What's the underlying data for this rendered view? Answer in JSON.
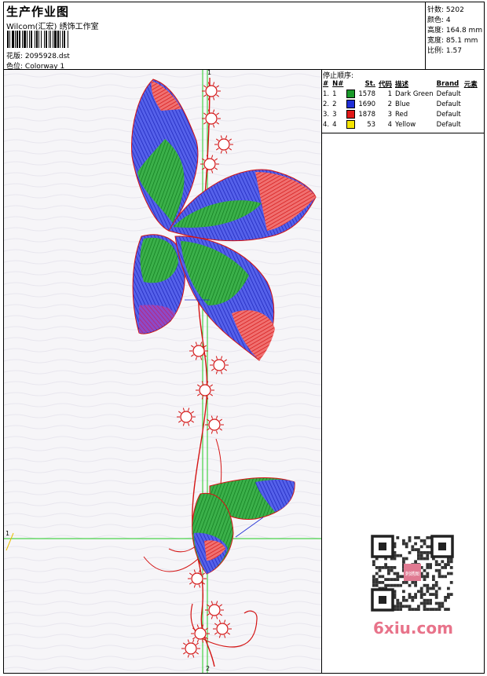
{
  "header": {
    "title": "生产作业图",
    "company": "Wilcom(汇宏) 绣饰工作室",
    "file_label": "花版:",
    "file_value": "2095928.dst",
    "colorway_label": "色位:",
    "colorway_value": "Colorway 1"
  },
  "stats": {
    "stitches_label": "针数:",
    "stitches_value": "5202",
    "colors_label": "颜色:",
    "colors_value": "4",
    "height_label": "高度:",
    "height_value": "164.8 mm",
    "width_label": "宽度:",
    "width_value": "85.1 mm",
    "scale_label": "比例:",
    "scale_value": "1.57"
  },
  "stop_sequence": {
    "title": "停止顺序:",
    "headers": [
      "#",
      "N#",
      "St.",
      "代码",
      "描述",
      "Brand",
      "元素"
    ],
    "rows": [
      {
        "num": "1.",
        "n": "1",
        "color": "#1a9a2a",
        "stitches": "1578",
        "code": "1",
        "desc": "Dark Green",
        "brand": "Default"
      },
      {
        "num": "2.",
        "n": "2",
        "color": "#1f2ed6",
        "stitches": "1690",
        "code": "2",
        "desc": "Blue",
        "brand": "Default"
      },
      {
        "num": "3.",
        "n": "3",
        "color": "#e01818",
        "stitches": "1878",
        "code": "3",
        "desc": "Red",
        "brand": "Default"
      },
      {
        "num": "4.",
        "n": "4",
        "color": "#f5e400",
        "stitches": "53",
        "code": "4",
        "desc": "Yellow",
        "brand": "Default"
      }
    ]
  },
  "axes": {
    "top": "1",
    "bottom": "2",
    "left": "1"
  },
  "watermark": {
    "text": "6xiu.com",
    "seal_text": "刺绣图"
  },
  "colors": {
    "green": "#1a9a2a",
    "blue": "#1f2ed6",
    "red": "#e01818",
    "guide": "#22cc22"
  }
}
